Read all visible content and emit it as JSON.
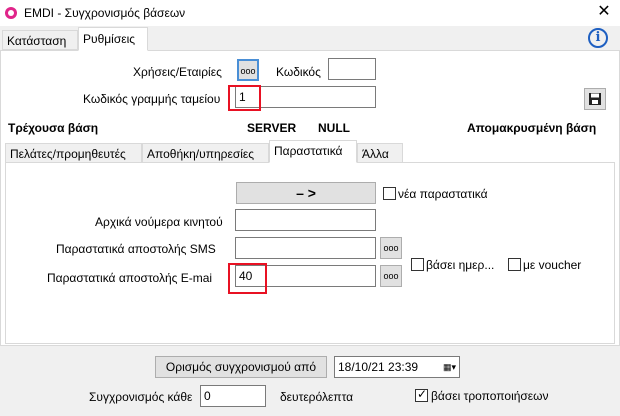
{
  "window": {
    "title": "EMDI - Συγχρονισμός βάσεων"
  },
  "tabs_top": [
    "Κατάσταση",
    "Ρυθμίσεις"
  ],
  "settings": {
    "years_companies_label": "Χρήσεις/Εταιρίες",
    "code_label": "Κωδικός",
    "code_value": "",
    "register_code_label": "Κωδικός γραμμής ταμείου",
    "register_code_value": "1",
    "dots": "ooo"
  },
  "header_row": {
    "current_db": "Τρέχουσα βάση",
    "server": "SERVER",
    "null": "NULL",
    "remote_db": "Απομακρυσμένη βάση"
  },
  "inner_tabs": [
    "Πελάτες/προμηθευτές",
    "Αποθήκη/υπηρεσίες",
    "Παραστατικά",
    "Άλλα"
  ],
  "documents_tab": {
    "arrow_button": "–   >",
    "new_documents_label": "νέα παραστατικά",
    "initial_mobile_numbers_label": "Αρχικά νούμερα κινητού",
    "initial_mobile_numbers_value": "",
    "sms_docs_label": "Παραστατικά αποστολής SMS",
    "sms_docs_value": "",
    "email_docs_label": "Παραστατικά αποστολής E-mai",
    "email_docs_value": "40",
    "based_on_day_label": "βάσει ημερ...",
    "with_voucher_label": "με voucher"
  },
  "footer": {
    "set_sync_from_button": "Ορισμός συγχρονισμού από",
    "datetime_value": "18/10/21 23:39",
    "sync_every_label": "Συγχρονισμός κάθε",
    "sync_every_value": "0",
    "seconds_label": "δευτερόλεπτα",
    "based_on_changes_label": "βάσει τροποποιήσεων",
    "based_on_changes_checked": true
  }
}
